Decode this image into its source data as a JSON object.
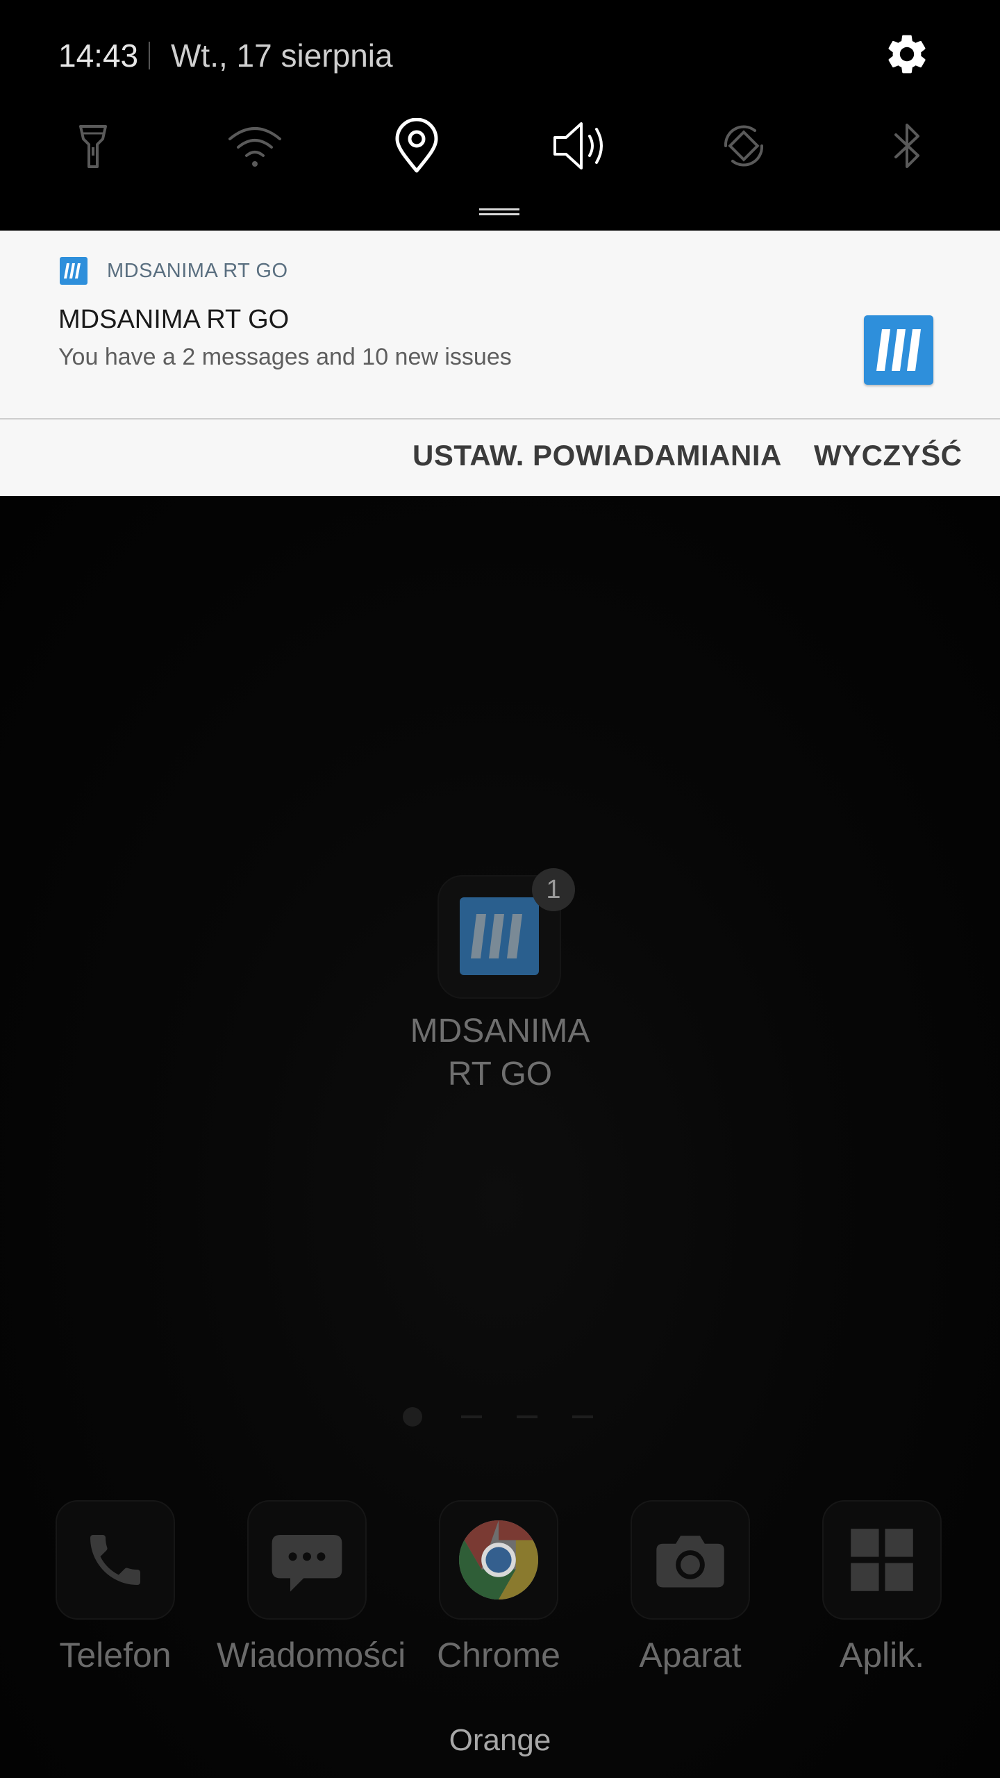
{
  "status": {
    "time": "14:43",
    "date": "Wt., 17 sierpnia"
  },
  "quick_settings": [
    {
      "name": "flashlight-icon",
      "active": false
    },
    {
      "name": "wifi-icon",
      "active": false
    },
    {
      "name": "location-icon",
      "active": true
    },
    {
      "name": "sound-icon",
      "active": true
    },
    {
      "name": "auto-rotate-icon",
      "active": false
    },
    {
      "name": "bluetooth-icon",
      "active": false
    }
  ],
  "notification": {
    "app_name": "MDSANIMA RT GO",
    "title": "MDSANIMA RT GO",
    "text": "You have a 2 messages and 10 new issues",
    "actions": {
      "settings_label": "USTAW. POWIADAMIANIA",
      "clear_label": "WYCZYŚĆ"
    }
  },
  "home": {
    "app_label_line1": "MDSANIMA",
    "app_label_line2": "RT GO",
    "badge_count": "1",
    "dock": [
      {
        "label": "Telefon",
        "icon": "phone-icon"
      },
      {
        "label": "Wiadomości",
        "icon": "messages-icon"
      },
      {
        "label": "Chrome",
        "icon": "chrome-icon"
      },
      {
        "label": "Aparat",
        "icon": "camera-icon"
      },
      {
        "label": "Aplik.",
        "icon": "apps-grid-icon"
      }
    ],
    "carrier": "Orange"
  },
  "colors": {
    "accent_blue": "#2e8fdb",
    "panel_bg": "#000000",
    "notification_bg": "#f7f7f7"
  }
}
